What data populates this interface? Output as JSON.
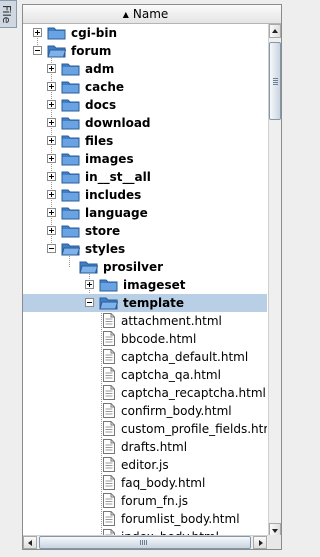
{
  "side_tab": {
    "label": "File"
  },
  "column_header": {
    "label": "Name",
    "sort_icon": "▲"
  },
  "colors": {
    "selection": "#b8cfe5",
    "folder_blue": "#4f8fd6"
  },
  "tree_rows": [
    {
      "label": "cgi-bin",
      "type": "folder",
      "depth": 0,
      "expanded": false
    },
    {
      "label": "forum",
      "type": "folder",
      "depth": 0,
      "expanded": true
    },
    {
      "label": "adm",
      "type": "folder",
      "depth": 1,
      "expanded": false
    },
    {
      "label": "cache",
      "type": "folder",
      "depth": 1,
      "expanded": false
    },
    {
      "label": "docs",
      "type": "folder",
      "depth": 1,
      "expanded": false
    },
    {
      "label": "download",
      "type": "folder",
      "depth": 1,
      "expanded": false
    },
    {
      "label": "files",
      "type": "folder",
      "depth": 1,
      "expanded": false
    },
    {
      "label": "images",
      "type": "folder",
      "depth": 1,
      "expanded": false
    },
    {
      "label": "in__st__all",
      "type": "folder",
      "depth": 1,
      "expanded": false
    },
    {
      "label": "includes",
      "type": "folder",
      "depth": 1,
      "expanded": false
    },
    {
      "label": "language",
      "type": "folder",
      "depth": 1,
      "expanded": false
    },
    {
      "label": "store",
      "type": "folder",
      "depth": 1,
      "expanded": false
    },
    {
      "label": "styles",
      "type": "folder",
      "depth": 1,
      "expanded": true
    },
    {
      "label": "prosilver",
      "type": "folder",
      "depth": 2,
      "expanded": true,
      "no_toggle": true
    },
    {
      "label": "imageset",
      "type": "folder",
      "depth": 3,
      "expanded": false
    },
    {
      "label": "template",
      "type": "folder",
      "depth": 3,
      "expanded": true,
      "selected": true
    },
    {
      "label": "attachment.html",
      "type": "file",
      "depth": 4
    },
    {
      "label": "bbcode.html",
      "type": "file",
      "depth": 4
    },
    {
      "label": "captcha_default.html",
      "type": "file",
      "depth": 4
    },
    {
      "label": "captcha_qa.html",
      "type": "file",
      "depth": 4
    },
    {
      "label": "captcha_recaptcha.html",
      "type": "file",
      "depth": 4
    },
    {
      "label": "confirm_body.html",
      "type": "file",
      "depth": 4
    },
    {
      "label": "custom_profile_fields.html",
      "type": "file",
      "depth": 4
    },
    {
      "label": "drafts.html",
      "type": "file",
      "depth": 4
    },
    {
      "label": "editor.js",
      "type": "file",
      "depth": 4
    },
    {
      "label": "faq_body.html",
      "type": "file",
      "depth": 4
    },
    {
      "label": "forum_fn.js",
      "type": "file",
      "depth": 4
    },
    {
      "label": "forumlist_body.html",
      "type": "file",
      "depth": 4
    },
    {
      "label": "index_body.html",
      "type": "file",
      "depth": 4
    }
  ]
}
